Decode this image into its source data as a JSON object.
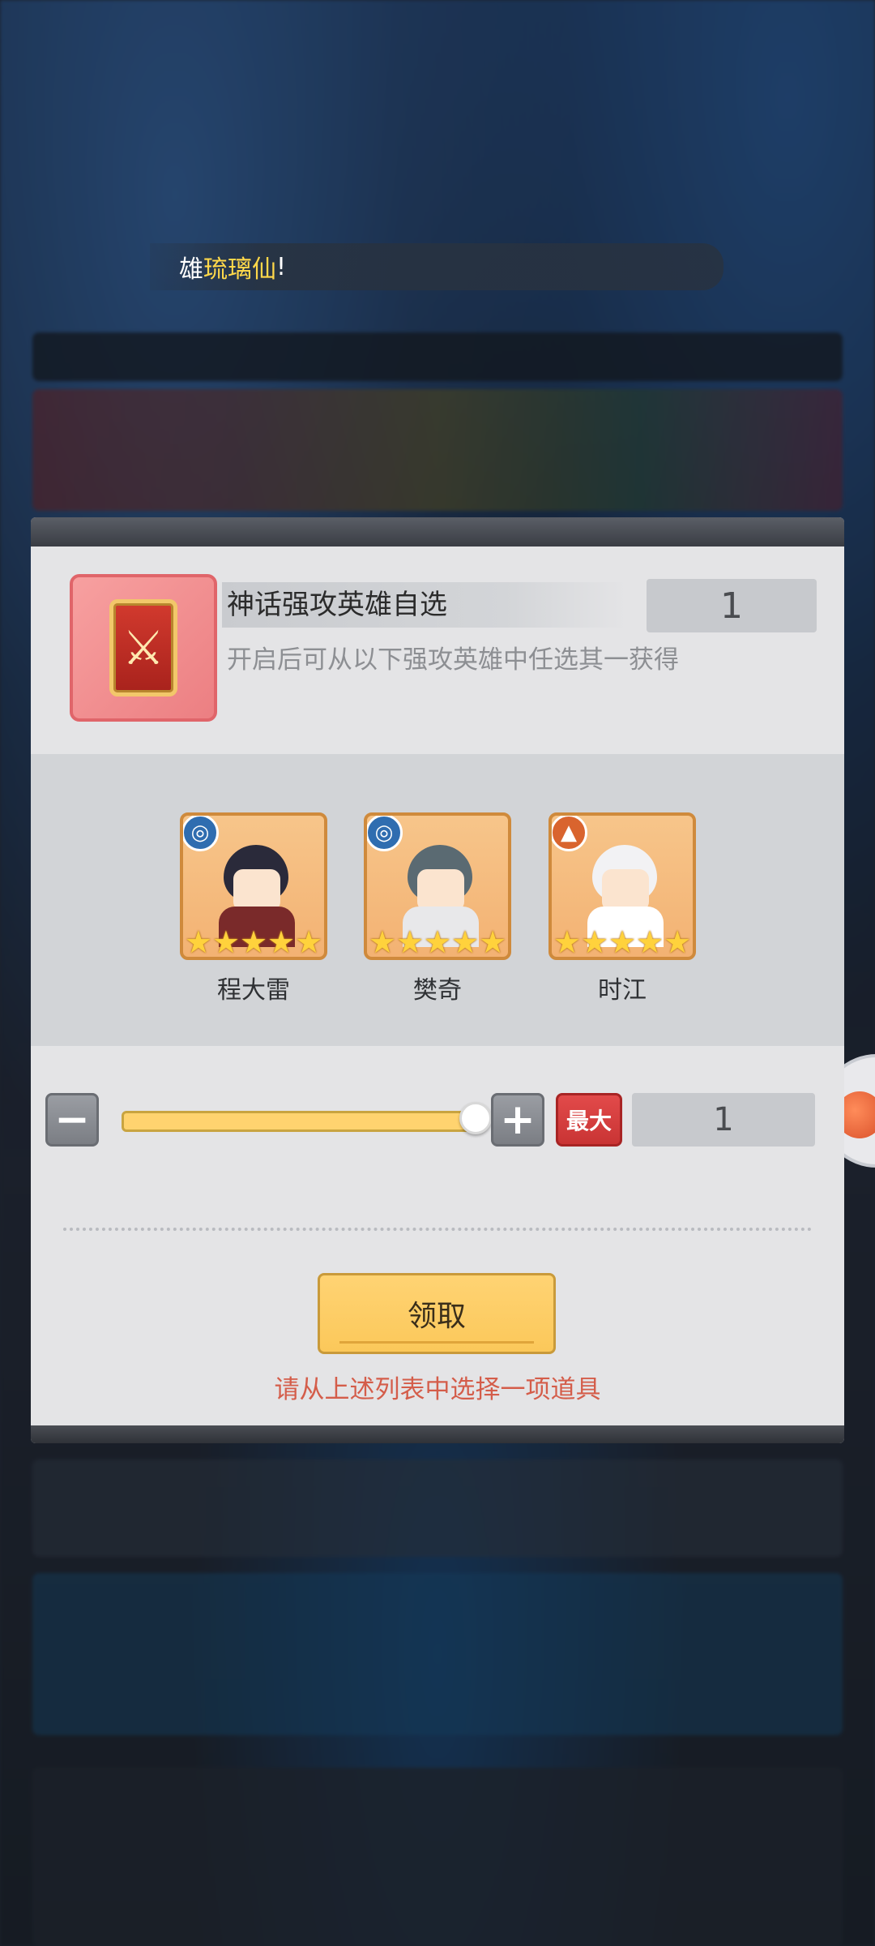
{
  "notice": {
    "prefix": "雄",
    "highlight": "琉璃仙",
    "suffix": "!"
  },
  "item": {
    "title": "神话强攻英雄自选",
    "count": "1",
    "description": "开启后可从以下强攻英雄中任选其一获得",
    "icon": "sword-card-icon"
  },
  "heroes": [
    {
      "name": "程大雷",
      "element": "water",
      "stars": 5
    },
    {
      "name": "樊奇",
      "element": "water",
      "stars": 5
    },
    {
      "name": "时江",
      "element": "fire",
      "stars": 5
    }
  ],
  "quantity": {
    "minus_label": "−",
    "plus_label": "+",
    "max_label": "最大",
    "value": "1",
    "slider_fraction": 1.0
  },
  "actions": {
    "claim_label": "领取",
    "hint": "请从上述列表中选择一项道具"
  },
  "colors": {
    "accent": "#ffd36f",
    "hint": "#d45d4a",
    "max_button": "#d93f3f"
  }
}
